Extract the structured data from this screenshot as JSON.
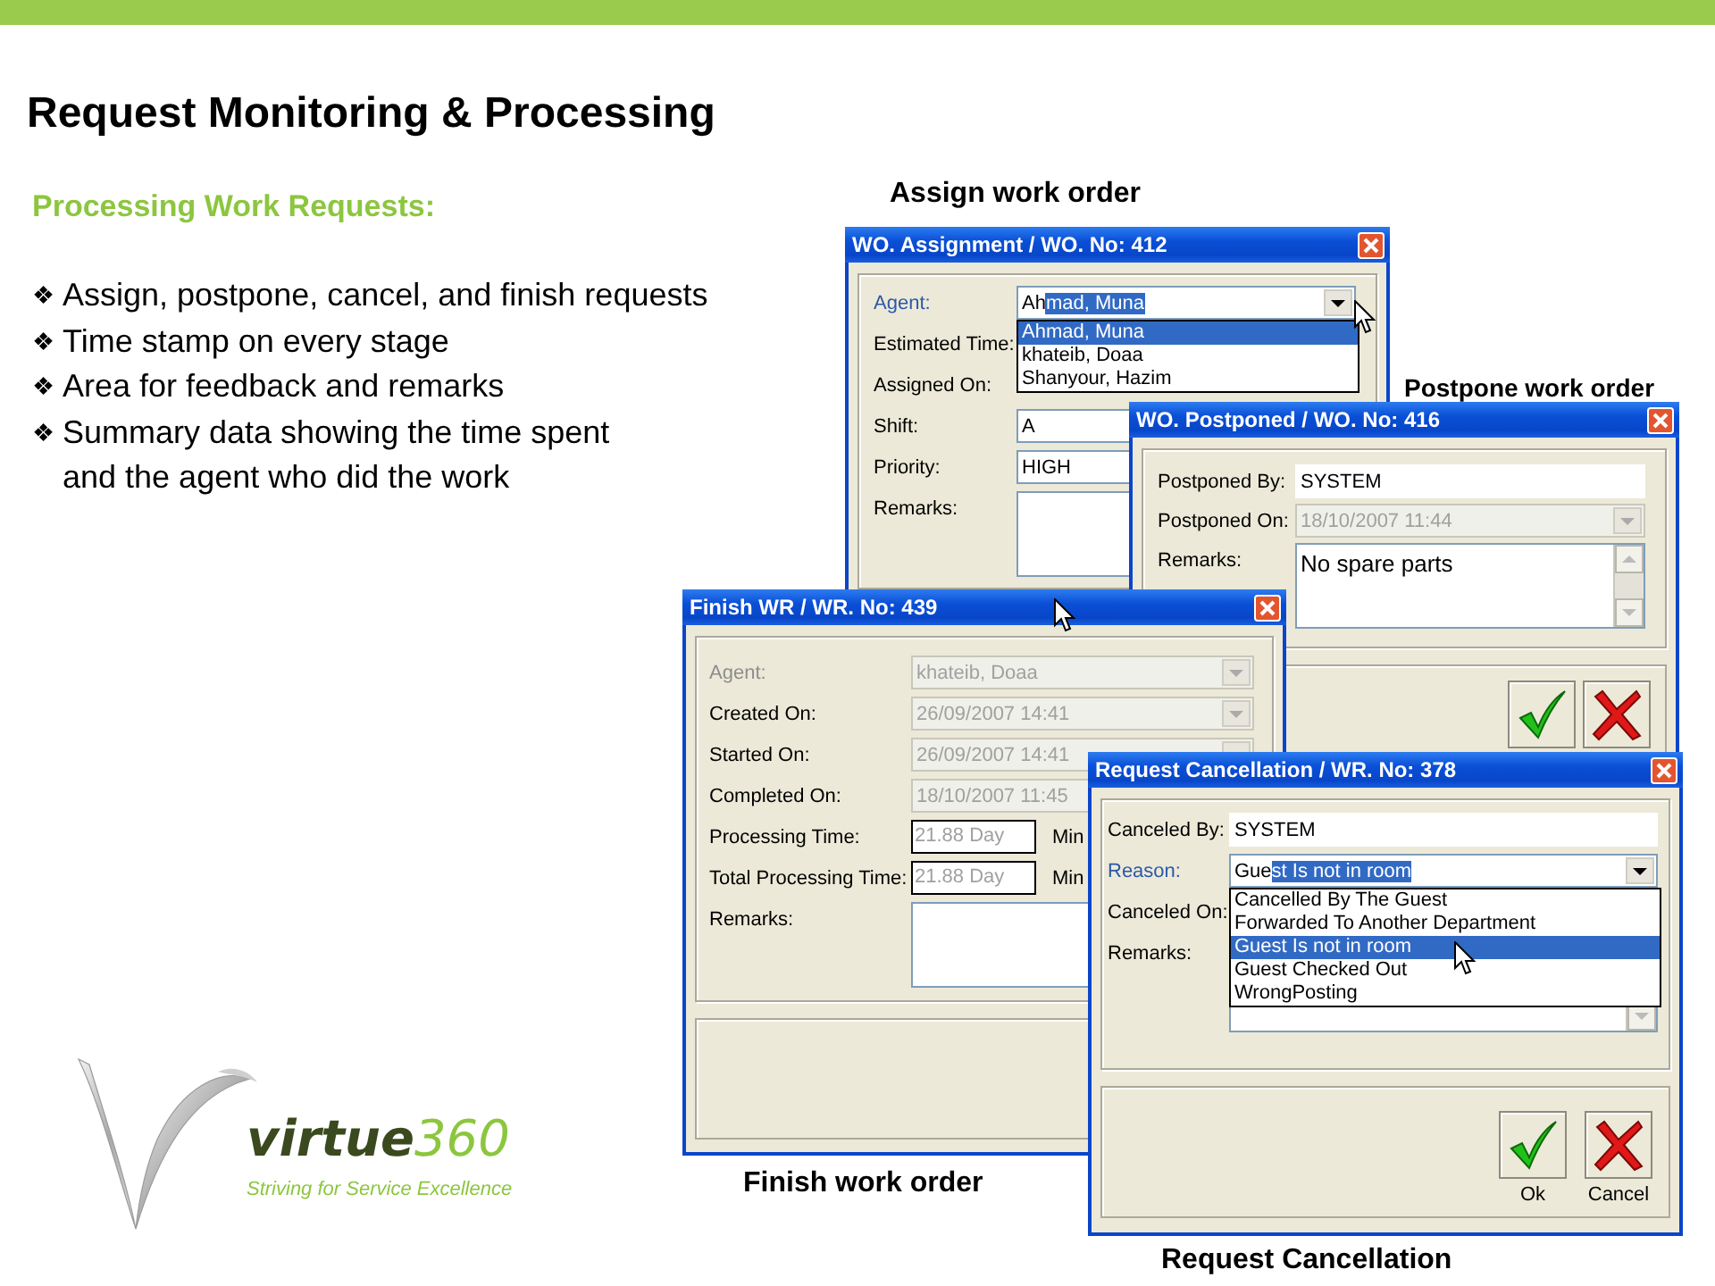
{
  "slide": {
    "title": "Request Monitoring & Processing",
    "subtitle": "Processing Work Requests:",
    "bullets": [
      {
        "marker": "❖",
        "text": "Assign, postpone, cancel, and finish requests"
      },
      {
        "marker": "❖",
        "text": "Time stamp on every stage"
      },
      {
        "marker": "❖",
        "text": "Area for feedback and remarks"
      },
      {
        "marker": "❖",
        "text": "Summary data showing the time spent\nand the agent who did the work"
      }
    ]
  },
  "logo": {
    "word": "virtue",
    "number": "360",
    "tagline": "Striving for Service Excellence"
  },
  "windows": [
    {
      "kind": "assign",
      "caption": "Assign work order",
      "title": "WO. Assignment / WO. No: 412",
      "rows": [
        {
          "kind": "combo",
          "label": "Agent:",
          "label_accent": true,
          "label_dim": false,
          "disabled": false,
          "value": "Ah",
          "highlighted": "mad, Muna",
          "options": [
            {
              "text": "Ahmad, Muna",
              "selected": true
            },
            {
              "text": "khateib, Doaa",
              "selected": false
            },
            {
              "text": "Shanyour, Hazim",
              "selected": false
            }
          ]
        },
        {
          "kind": "label",
          "label": "Estimated Time:",
          "label_accent": false,
          "label_dim": false
        },
        {
          "kind": "label",
          "label": "Assigned On:",
          "label_accent": false,
          "label_dim": false
        },
        {
          "kind": "text",
          "label": "Shift:",
          "label_accent": false,
          "label_dim": false,
          "disabled": false,
          "value": "A"
        },
        {
          "kind": "text",
          "label": "Priority:",
          "label_accent": false,
          "label_dim": false,
          "disabled": false,
          "value": "HIGH"
        },
        {
          "kind": "memo",
          "label": "Remarks:",
          "label_accent": false,
          "label_dim": false
        }
      ]
    },
    {
      "kind": "postpone",
      "caption": "Postpone work order",
      "title": "WO. Postponed / WO. No: 416",
      "rows": [
        {
          "kind": "text",
          "label": "Postponed By:",
          "label_accent": false,
          "label_dim": false,
          "disabled": false,
          "value": "SYSTEM"
        },
        {
          "kind": "combo",
          "label": "Postponed On:",
          "label_accent": false,
          "label_dim": false,
          "disabled": true,
          "value": "18/10/2007 11:44"
        },
        {
          "kind": "memo",
          "label": "Remarks:",
          "label_accent": false,
          "label_dim": false,
          "value": "No spare parts",
          "scrollbar": true
        }
      ],
      "buttons": [
        {
          "kind": "ok"
        },
        {
          "kind": "cancel"
        }
      ]
    },
    {
      "kind": "finish",
      "caption": "Finish work order",
      "title": "Finish WR / WR. No: 439",
      "rows": [
        {
          "kind": "combo",
          "label": "Agent:",
          "label_accent": false,
          "label_dim": true,
          "disabled": true,
          "value": "khateib, Doaa"
        },
        {
          "kind": "combo",
          "label": "Created On:",
          "label_accent": false,
          "label_dim": false,
          "disabled": true,
          "value": "26/09/2007 14:41"
        },
        {
          "kind": "combo",
          "label": "Started On:",
          "label_accent": false,
          "label_dim": false,
          "disabled": true,
          "value": "26/09/2007 14:41"
        },
        {
          "kind": "text",
          "label": "Completed On:",
          "label_accent": false,
          "label_dim": false,
          "disabled": true,
          "value": "18/10/2007 11:45"
        },
        {
          "kind": "duration",
          "label": "Processing Time:",
          "label_accent": false,
          "label_dim": false,
          "disabled": true,
          "value": "21.88 Day",
          "unit": "Min"
        },
        {
          "kind": "duration",
          "label": "Total Processing Time:",
          "label_accent": false,
          "label_dim": false,
          "disabled": true,
          "value": "21.88 Day",
          "unit": "Min"
        },
        {
          "kind": "memo",
          "label": "Remarks:",
          "label_accent": false,
          "label_dim": false
        }
      ]
    },
    {
      "kind": "cancel",
      "caption": "Request Cancellation",
      "title": "Request Cancellation / WR. No: 378",
      "rows": [
        {
          "kind": "text",
          "label": "Canceled By:",
          "label_accent": false,
          "label_dim": false,
          "disabled": false,
          "value": "SYSTEM"
        },
        {
          "kind": "combo",
          "label": "Reason:",
          "label_accent": true,
          "label_dim": false,
          "disabled": false,
          "value": "Gue",
          "highlighted": "st Is not in room",
          "options": [
            {
              "text": "Cancelled By The Guest",
              "selected": false
            },
            {
              "text": "Forwarded To Another Department",
              "selected": false
            },
            {
              "text": "Guest Is not in room",
              "selected": true
            },
            {
              "text": "Guest Checked Out",
              "selected": false
            },
            {
              "text": "WrongPosting",
              "selected": false
            }
          ]
        },
        {
          "kind": "label",
          "label": "Canceled On:",
          "label_accent": false,
          "label_dim": false
        },
        {
          "kind": "memo",
          "label": "Remarks:",
          "label_accent": false,
          "label_dim": false,
          "scrollbar": true
        }
      ],
      "buttons": [
        {
          "kind": "ok",
          "label": "Ok"
        },
        {
          "kind": "cancel",
          "label": "Cancel"
        }
      ]
    }
  ]
}
